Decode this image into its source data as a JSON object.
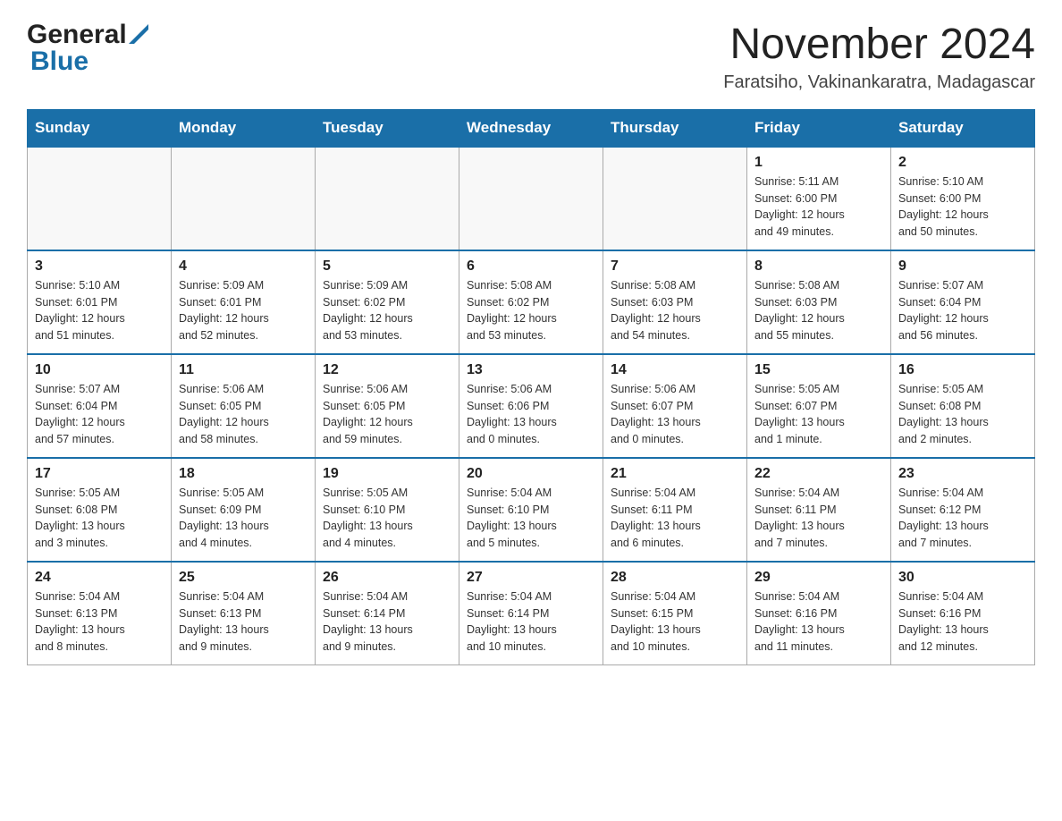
{
  "header": {
    "logo_general": "General",
    "logo_blue": "Blue",
    "title": "November 2024",
    "subtitle": "Faratsiho, Vakinankaratra, Madagascar"
  },
  "calendar": {
    "days_of_week": [
      "Sunday",
      "Monday",
      "Tuesday",
      "Wednesday",
      "Thursday",
      "Friday",
      "Saturday"
    ],
    "weeks": [
      [
        {
          "day": "",
          "info": ""
        },
        {
          "day": "",
          "info": ""
        },
        {
          "day": "",
          "info": ""
        },
        {
          "day": "",
          "info": ""
        },
        {
          "day": "",
          "info": ""
        },
        {
          "day": "1",
          "info": "Sunrise: 5:11 AM\nSunset: 6:00 PM\nDaylight: 12 hours\nand 49 minutes."
        },
        {
          "day": "2",
          "info": "Sunrise: 5:10 AM\nSunset: 6:00 PM\nDaylight: 12 hours\nand 50 minutes."
        }
      ],
      [
        {
          "day": "3",
          "info": "Sunrise: 5:10 AM\nSunset: 6:01 PM\nDaylight: 12 hours\nand 51 minutes."
        },
        {
          "day": "4",
          "info": "Sunrise: 5:09 AM\nSunset: 6:01 PM\nDaylight: 12 hours\nand 52 minutes."
        },
        {
          "day": "5",
          "info": "Sunrise: 5:09 AM\nSunset: 6:02 PM\nDaylight: 12 hours\nand 53 minutes."
        },
        {
          "day": "6",
          "info": "Sunrise: 5:08 AM\nSunset: 6:02 PM\nDaylight: 12 hours\nand 53 minutes."
        },
        {
          "day": "7",
          "info": "Sunrise: 5:08 AM\nSunset: 6:03 PM\nDaylight: 12 hours\nand 54 minutes."
        },
        {
          "day": "8",
          "info": "Sunrise: 5:08 AM\nSunset: 6:03 PM\nDaylight: 12 hours\nand 55 minutes."
        },
        {
          "day": "9",
          "info": "Sunrise: 5:07 AM\nSunset: 6:04 PM\nDaylight: 12 hours\nand 56 minutes."
        }
      ],
      [
        {
          "day": "10",
          "info": "Sunrise: 5:07 AM\nSunset: 6:04 PM\nDaylight: 12 hours\nand 57 minutes."
        },
        {
          "day": "11",
          "info": "Sunrise: 5:06 AM\nSunset: 6:05 PM\nDaylight: 12 hours\nand 58 minutes."
        },
        {
          "day": "12",
          "info": "Sunrise: 5:06 AM\nSunset: 6:05 PM\nDaylight: 12 hours\nand 59 minutes."
        },
        {
          "day": "13",
          "info": "Sunrise: 5:06 AM\nSunset: 6:06 PM\nDaylight: 13 hours\nand 0 minutes."
        },
        {
          "day": "14",
          "info": "Sunrise: 5:06 AM\nSunset: 6:07 PM\nDaylight: 13 hours\nand 0 minutes."
        },
        {
          "day": "15",
          "info": "Sunrise: 5:05 AM\nSunset: 6:07 PM\nDaylight: 13 hours\nand 1 minute."
        },
        {
          "day": "16",
          "info": "Sunrise: 5:05 AM\nSunset: 6:08 PM\nDaylight: 13 hours\nand 2 minutes."
        }
      ],
      [
        {
          "day": "17",
          "info": "Sunrise: 5:05 AM\nSunset: 6:08 PM\nDaylight: 13 hours\nand 3 minutes."
        },
        {
          "day": "18",
          "info": "Sunrise: 5:05 AM\nSunset: 6:09 PM\nDaylight: 13 hours\nand 4 minutes."
        },
        {
          "day": "19",
          "info": "Sunrise: 5:05 AM\nSunset: 6:10 PM\nDaylight: 13 hours\nand 4 minutes."
        },
        {
          "day": "20",
          "info": "Sunrise: 5:04 AM\nSunset: 6:10 PM\nDaylight: 13 hours\nand 5 minutes."
        },
        {
          "day": "21",
          "info": "Sunrise: 5:04 AM\nSunset: 6:11 PM\nDaylight: 13 hours\nand 6 minutes."
        },
        {
          "day": "22",
          "info": "Sunrise: 5:04 AM\nSunset: 6:11 PM\nDaylight: 13 hours\nand 7 minutes."
        },
        {
          "day": "23",
          "info": "Sunrise: 5:04 AM\nSunset: 6:12 PM\nDaylight: 13 hours\nand 7 minutes."
        }
      ],
      [
        {
          "day": "24",
          "info": "Sunrise: 5:04 AM\nSunset: 6:13 PM\nDaylight: 13 hours\nand 8 minutes."
        },
        {
          "day": "25",
          "info": "Sunrise: 5:04 AM\nSunset: 6:13 PM\nDaylight: 13 hours\nand 9 minutes."
        },
        {
          "day": "26",
          "info": "Sunrise: 5:04 AM\nSunset: 6:14 PM\nDaylight: 13 hours\nand 9 minutes."
        },
        {
          "day": "27",
          "info": "Sunrise: 5:04 AM\nSunset: 6:14 PM\nDaylight: 13 hours\nand 10 minutes."
        },
        {
          "day": "28",
          "info": "Sunrise: 5:04 AM\nSunset: 6:15 PM\nDaylight: 13 hours\nand 10 minutes."
        },
        {
          "day": "29",
          "info": "Sunrise: 5:04 AM\nSunset: 6:16 PM\nDaylight: 13 hours\nand 11 minutes."
        },
        {
          "day": "30",
          "info": "Sunrise: 5:04 AM\nSunset: 6:16 PM\nDaylight: 13 hours\nand 12 minutes."
        }
      ]
    ]
  }
}
